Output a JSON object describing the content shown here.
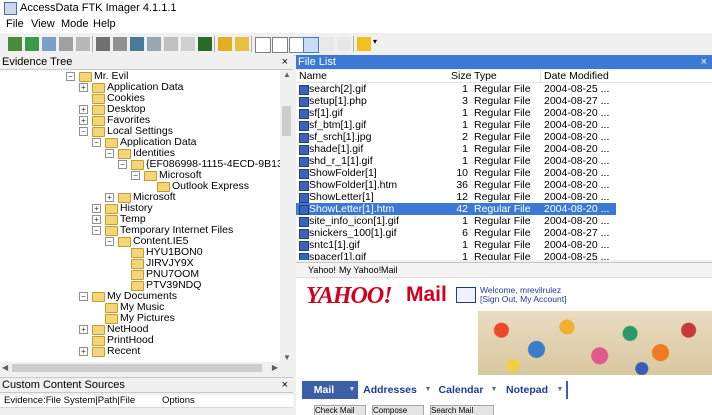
{
  "window": {
    "title": "AccessData FTK Imager 4.1.1.1"
  },
  "menu": [
    "File",
    "View",
    "Mode",
    "Help"
  ],
  "panels": {
    "evidence_tree": "Evidence Tree",
    "file_list": "File List",
    "custom_content": "Custom Content Sources",
    "close": "×"
  },
  "tree": [
    {
      "label": "Mr. Evil",
      "indent": 0,
      "exp": "−"
    },
    {
      "label": "Application Data",
      "indent": 1,
      "exp": "+"
    },
    {
      "label": "Cookies",
      "indent": 1,
      "exp": ""
    },
    {
      "label": "Desktop",
      "indent": 1,
      "exp": "+"
    },
    {
      "label": "Favorites",
      "indent": 1,
      "exp": "+"
    },
    {
      "label": "Local Settings",
      "indent": 1,
      "exp": "−"
    },
    {
      "label": "Application Data",
      "indent": 2,
      "exp": "−"
    },
    {
      "label": "Identities",
      "indent": 3,
      "exp": "−"
    },
    {
      "label": "{EF086998-1115-4ECD-9B13-9AD0",
      "indent": 4,
      "exp": "−"
    },
    {
      "label": "Microsoft",
      "indent": 5,
      "exp": "−"
    },
    {
      "label": "Outlook Express",
      "indent": 6,
      "exp": ""
    },
    {
      "label": "Microsoft",
      "indent": 3,
      "exp": "+"
    },
    {
      "label": "History",
      "indent": 2,
      "exp": "+"
    },
    {
      "label": "Temp",
      "indent": 2,
      "exp": "+"
    },
    {
      "label": "Temporary Internet Files",
      "indent": 2,
      "exp": "−"
    },
    {
      "label": "Content.IE5",
      "indent": 3,
      "exp": "−"
    },
    {
      "label": "HYU1BON0",
      "indent": 4,
      "exp": ""
    },
    {
      "label": "JIRVJY9X",
      "indent": 4,
      "exp": ""
    },
    {
      "label": "PNU7OOM",
      "indent": 4,
      "exp": ""
    },
    {
      "label": "PTV39NDQ",
      "indent": 4,
      "exp": ""
    },
    {
      "label": "My Documents",
      "indent": 1,
      "exp": "−"
    },
    {
      "label": "My Music",
      "indent": 2,
      "exp": ""
    },
    {
      "label": "My Pictures",
      "indent": 2,
      "exp": ""
    },
    {
      "label": "NetHood",
      "indent": 1,
      "exp": "+"
    },
    {
      "label": "PrintHood",
      "indent": 1,
      "exp": ""
    },
    {
      "label": "Recent",
      "indent": 1,
      "exp": "+"
    }
  ],
  "custom_cols": [
    "Evidence:File System|Path|File",
    "Options"
  ],
  "file_list": {
    "columns": [
      "Name",
      "Size",
      "Type",
      "Date Modified"
    ],
    "rows": [
      {
        "name": "search[2].gif",
        "size": "1",
        "type": "Regular File",
        "date": "2004-08-25 ..."
      },
      {
        "name": "setup[1].php",
        "size": "3",
        "type": "Regular File",
        "date": "2004-08-27 ..."
      },
      {
        "name": "sf[1].gif",
        "size": "1",
        "type": "Regular File",
        "date": "2004-08-20 ..."
      },
      {
        "name": "sf_btm[1].gif",
        "size": "1",
        "type": "Regular File",
        "date": "2004-08-20 ..."
      },
      {
        "name": "sf_srch[1].jpg",
        "size": "2",
        "type": "Regular File",
        "date": "2004-08-20 ..."
      },
      {
        "name": "shade[1].gif",
        "size": "1",
        "type": "Regular File",
        "date": "2004-08-20 ..."
      },
      {
        "name": "shd_r_1[1].gif",
        "size": "1",
        "type": "Regular File",
        "date": "2004-08-20 ..."
      },
      {
        "name": "ShowFolder[1]",
        "size": "10",
        "type": "Regular File",
        "date": "2004-08-20 ..."
      },
      {
        "name": "ShowFolder[1].htm",
        "size": "36",
        "type": "Regular File",
        "date": "2004-08-20 ..."
      },
      {
        "name": "ShowLetter[1]",
        "size": "12",
        "type": "Regular File",
        "date": "2004-08-20 ..."
      },
      {
        "name": "ShowLetter[1].htm",
        "size": "42",
        "type": "Regular File",
        "date": "2004-08-20 ..."
      },
      {
        "name": "site_info_icon[1].gif",
        "size": "1",
        "type": "Regular File",
        "date": "2004-08-20 ..."
      },
      {
        "name": "snickers_100[1].gif",
        "size": "6",
        "type": "Regular File",
        "date": "2004-08-27 ..."
      },
      {
        "name": "sntc1[1].gif",
        "size": "1",
        "type": "Regular File",
        "date": "2004-08-20 ..."
      },
      {
        "name": "spacer[1].gif",
        "size": "1",
        "type": "Regular File",
        "date": "2004-08-25 ..."
      }
    ],
    "selected": 10
  },
  "yahoo": {
    "nav": [
      "Yahoo!",
      "My Yahoo!",
      "Mail"
    ],
    "logo": "YAHOO!",
    "mail": "Mail",
    "welcome": "Welcome, mrevilrulez",
    "signout": "[Sign Out, My Account]",
    "tabs": [
      "Mail",
      "Addresses",
      "Calendar",
      "Notepad"
    ],
    "buttons": [
      "Check Mail",
      "Compose",
      "Search Mail"
    ]
  }
}
